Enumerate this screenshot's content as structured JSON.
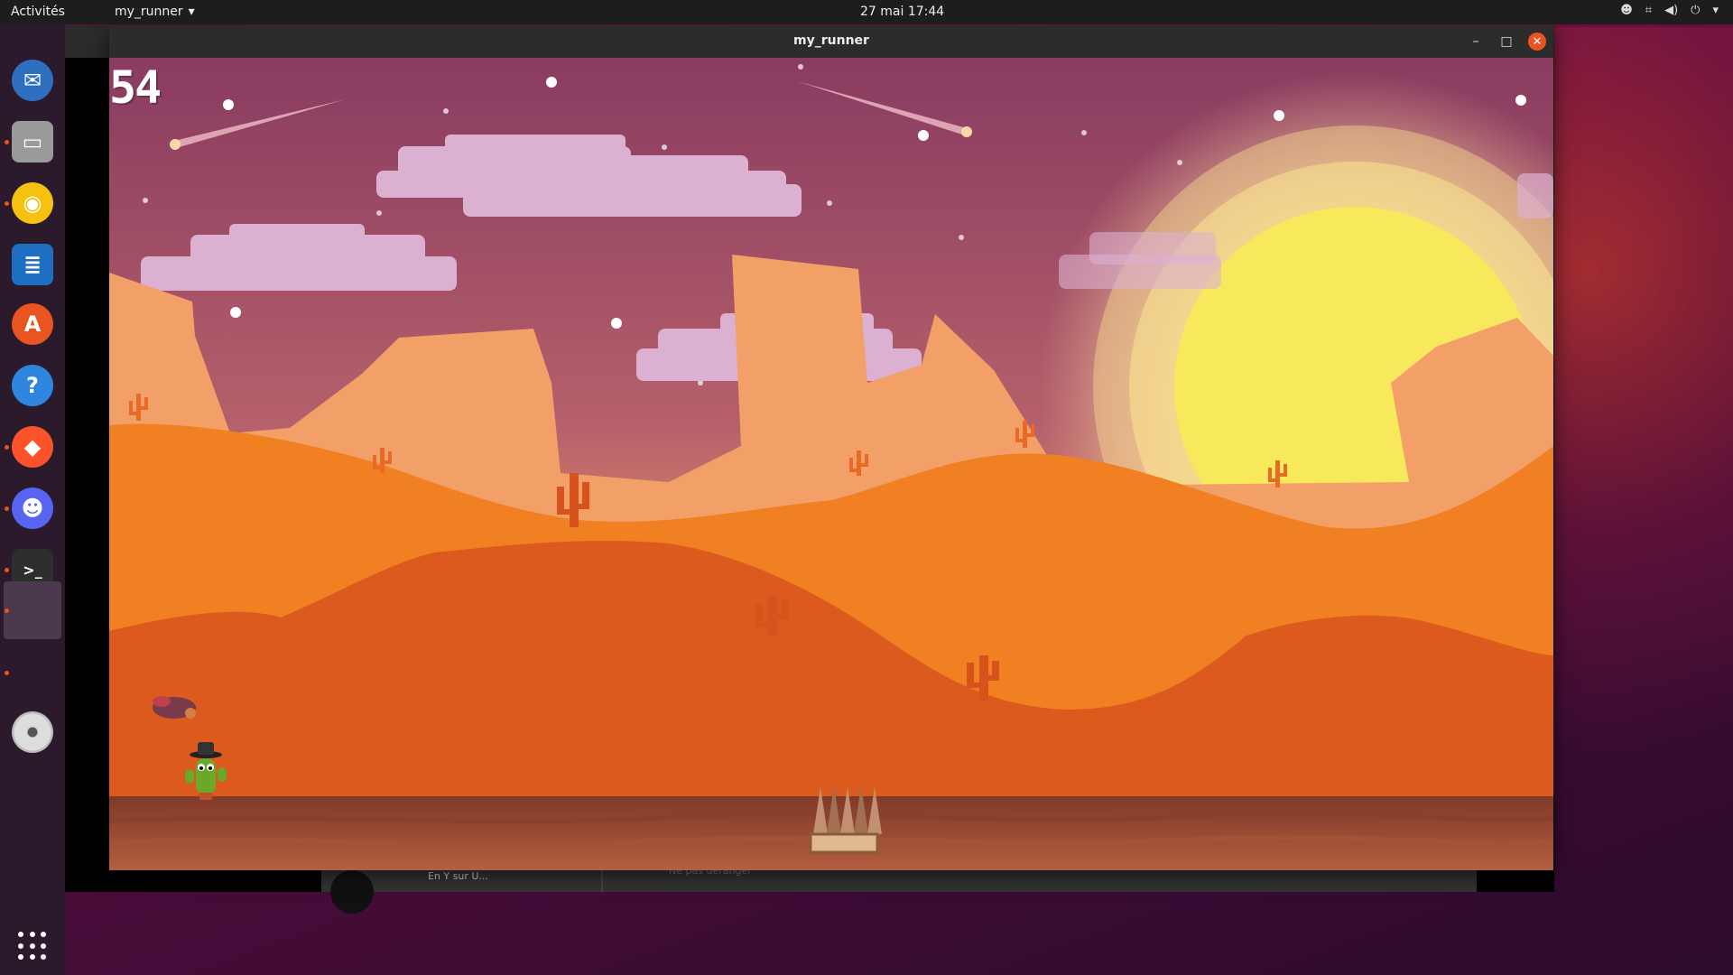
{
  "topbar": {
    "activities": "Activités",
    "app_menu": "my_runner",
    "clock": "27 mai  17:44"
  },
  "window": {
    "title": "my_runner",
    "minimize": "–",
    "maximize": "□",
    "close": "✕"
  },
  "game": {
    "score": "54"
  },
  "background_window": {
    "text": "En Y sur U...",
    "text2": "Ne pas déranger"
  },
  "dock": {
    "items": [
      {
        "name": "thunderbird-icon",
        "glyph": "✉",
        "color": "#2f6fbf"
      },
      {
        "name": "files-icon",
        "glyph": "▭",
        "color": "#9a9a9a"
      },
      {
        "name": "rhythmbox-icon",
        "glyph": "◉",
        "color": "#f5c211"
      },
      {
        "name": "writer-icon",
        "glyph": "≣",
        "color": "#1e6fc1"
      },
      {
        "name": "software-icon",
        "glyph": "A",
        "color": "#e95420"
      },
      {
        "name": "help-icon",
        "glyph": "?",
        "color": "#2e86de"
      },
      {
        "name": "brave-icon",
        "glyph": "◆",
        "color": "#fb542b"
      },
      {
        "name": "discord-icon",
        "glyph": "☻",
        "color": "#5865f2"
      },
      {
        "name": "terminal-icon",
        "glyph": ">_",
        "color": "#2e2e2e"
      }
    ]
  },
  "colors": {
    "ubuntu_orange": "#e95420",
    "sky_top": "#8b3c5f",
    "sky_bottom": "#f0a46a",
    "sun": "#f8e55a",
    "ground": "#7a3a2a"
  }
}
